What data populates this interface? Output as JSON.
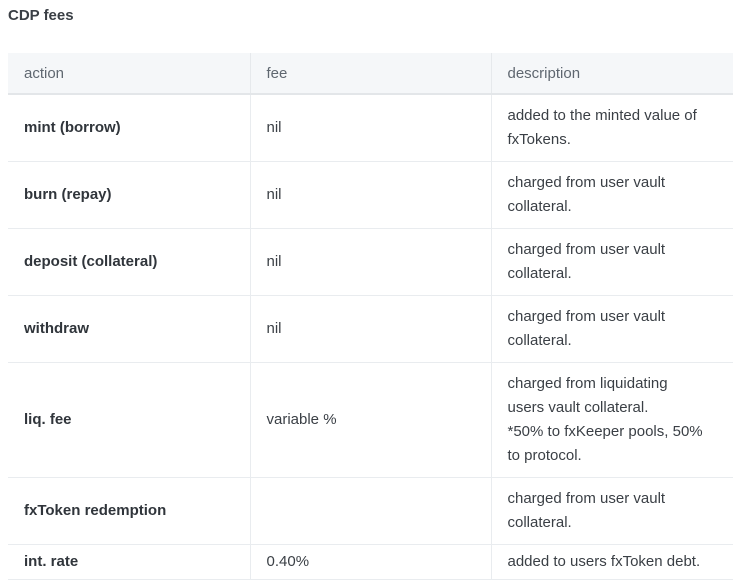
{
  "title": "CDP fees",
  "columns": {
    "action": "action",
    "fee": "fee",
    "description": "description"
  },
  "rows": [
    {
      "action": "mint (borrow)",
      "fee": "nil",
      "description": [
        "added to the minted value of",
        "fxTokens."
      ]
    },
    {
      "action": "burn (repay)",
      "fee": "nil",
      "description": [
        "charged from user vault",
        "collateral."
      ]
    },
    {
      "action": "deposit (collateral)",
      "fee": "nil",
      "description": [
        "charged from user vault",
        "collateral."
      ]
    },
    {
      "action": "withdraw",
      "fee": "nil",
      "description": [
        "charged from user vault",
        "collateral."
      ]
    },
    {
      "action": "liq. fee",
      "fee": "variable %",
      "description": [
        "charged from liquidating",
        "users vault collateral.",
        "*50% to fxKeeper pools, 50%",
        "to protocol."
      ]
    },
    {
      "action": "fxToken redemption",
      "fee": "",
      "description": [
        "charged from user vault",
        "collateral."
      ]
    },
    {
      "action": "int. rate",
      "fee": "0.40%",
      "description": [
        "added to users fxToken debt."
      ]
    }
  ]
}
